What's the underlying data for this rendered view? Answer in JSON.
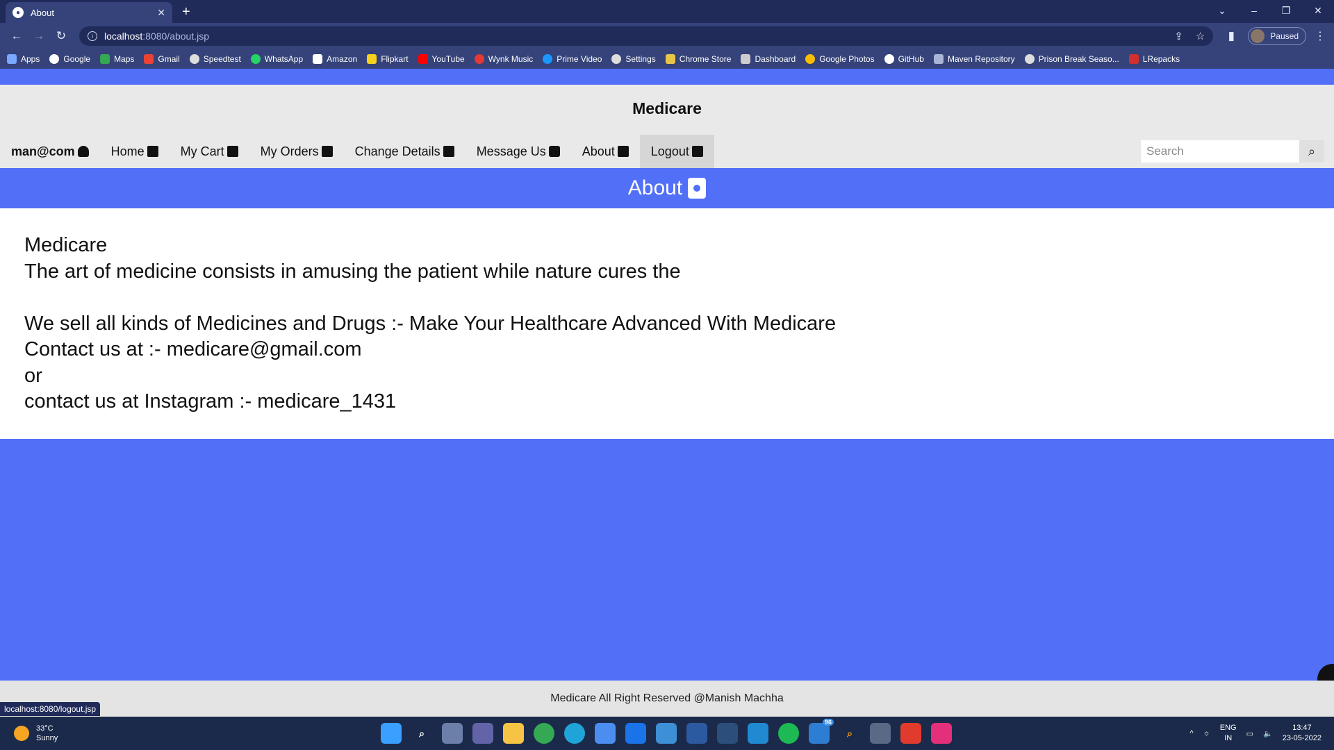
{
  "browser": {
    "tab_title": "About",
    "url_host": "localhost",
    "url_path": ":8080/about.jsp",
    "profile_status": "Paused",
    "bookmarks": [
      {
        "label": "Apps",
        "color": "#7aa7ff"
      },
      {
        "label": "Google",
        "color": "#ffffff"
      },
      {
        "label": "Maps",
        "color": "#34a853"
      },
      {
        "label": "Gmail",
        "color": "#ea4335"
      },
      {
        "label": "Speedtest",
        "color": "#dddddd"
      },
      {
        "label": "WhatsApp",
        "color": "#25d366"
      },
      {
        "label": "Amazon",
        "color": "#ffffff"
      },
      {
        "label": "Flipkart",
        "color": "#f7d21c"
      },
      {
        "label": "YouTube",
        "color": "#ff0000"
      },
      {
        "label": "Wynk Music",
        "color": "#e53935"
      },
      {
        "label": "Prime Video",
        "color": "#1a98ff"
      },
      {
        "label": "Settings",
        "color": "#dddddd"
      },
      {
        "label": "Chrome Store",
        "color": "#e8c547"
      },
      {
        "label": "Dashboard",
        "color": "#cccccc"
      },
      {
        "label": "Google Photos",
        "color": "#fbbc05"
      },
      {
        "label": "GitHub",
        "color": "#ffffff"
      },
      {
        "label": "Maven Repository",
        "color": "#aab4d6"
      },
      {
        "label": "Prison Break Seaso...",
        "color": "#dddddd"
      },
      {
        "label": "LRepacks",
        "color": "#d32f2f"
      }
    ]
  },
  "page": {
    "brand": "Medicare",
    "nav": {
      "user": "man@com",
      "home": "Home",
      "cart": "My Cart",
      "orders": "My Orders",
      "change_details": "Change Details",
      "message": "Message Us",
      "about": "About",
      "logout": "Logout"
    },
    "search": {
      "placeholder": "Search"
    },
    "banner_title": "About",
    "content": {
      "line1": "Medicare",
      "line2": "The art of medicine consists in amusing the patient while nature cures the",
      "line3": "We sell all kinds of Medicines and Drugs :- Make Your Healthcare Advanced With Medicare",
      "line4": "Contact us at :- medicare@gmail.com",
      "line5": "or",
      "line6": "contact us at Instagram :- medicare_1431"
    },
    "footer": "Medicare All Right Reserved @Manish Machha",
    "status_url": "localhost:8080/logout.jsp"
  },
  "taskbar": {
    "weather_temp": "33°C",
    "weather_desc": "Sunny",
    "lang_line1": "ENG",
    "lang_line2": "IN",
    "time": "13:47",
    "date": "23-05-2022",
    "badge": "96",
    "colors": {
      "accent": "#526ff7",
      "header": "#e9e9e9"
    }
  }
}
